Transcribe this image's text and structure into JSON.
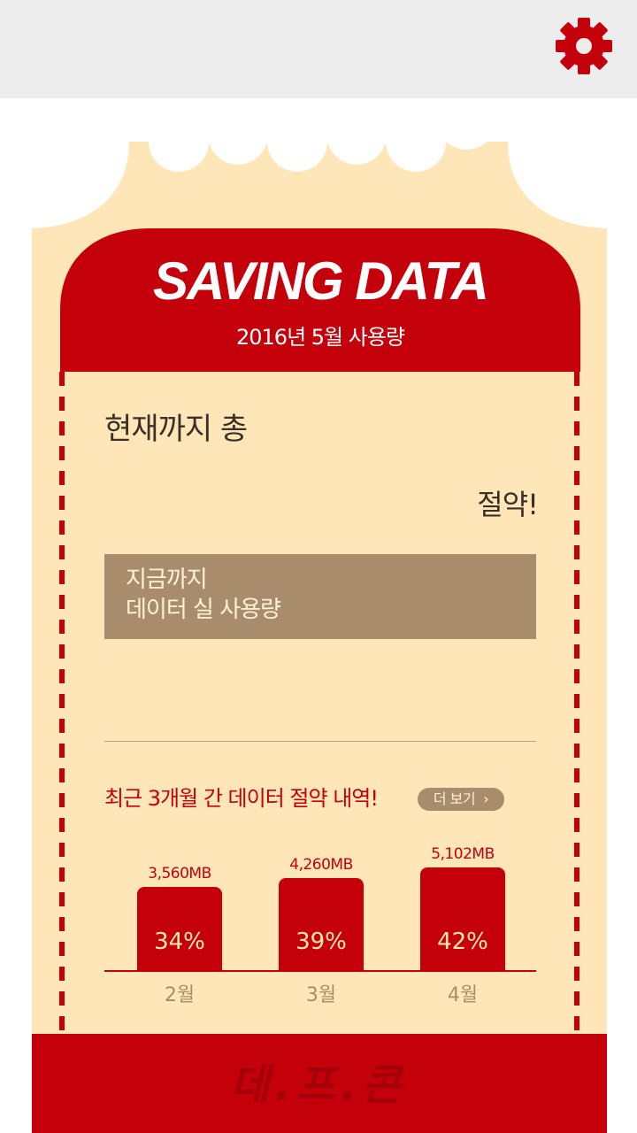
{
  "header": {
    "settings_icon": "gear-icon",
    "accent": "#c4000b"
  },
  "ticket": {
    "title": "SAVING DATA",
    "subtitle": "2016년 5월 사용량",
    "total_label": "현재까지 총",
    "saved_label": "절약!",
    "usage_line1": "지금까지",
    "usage_line2": "데이터 실 사용량"
  },
  "history": {
    "title": "최근 3개월 간 데이터 절약 내역!",
    "more_label": "더 보기",
    "more_icon": "chevron-right-icon"
  },
  "chart_data": {
    "type": "bar",
    "categories": [
      "2월",
      "3월",
      "4월"
    ],
    "values": [
      3560,
      4260,
      5102
    ],
    "value_labels": [
      "3,560MB",
      "4,260MB",
      "5,102MB"
    ],
    "percent_labels": [
      "34%",
      "39%",
      "42%"
    ]
  },
  "footer": {
    "logo_text": "데.프.콘"
  },
  "colors": {
    "red": "#c4000b",
    "cream": "#fee6b8",
    "brown": "#a98c6b"
  }
}
